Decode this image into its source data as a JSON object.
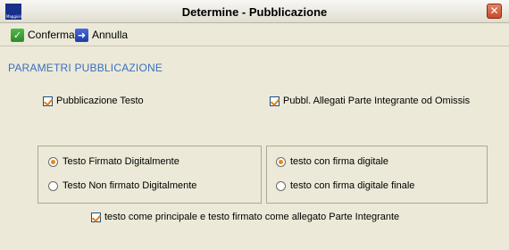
{
  "window": {
    "title": "Determine - Pubblicazione",
    "app_icon_text": "Maggioli",
    "close_glyph": "✕"
  },
  "toolbar": {
    "confirm_label": "Conferma",
    "cancel_label": "Annulla"
  },
  "section": {
    "title": "PARAMETRI PUBBLICAZIONE"
  },
  "checks": {
    "pub_testo": "Pubblicazione Testo",
    "pub_allegati": "Pubbl. Allegati Parte Integrante od Omissis",
    "principale": "testo come principale e testo firmato come allegato Parte Integrante"
  },
  "group_left": {
    "options": [
      "Testo Firmato Digitalmente",
      "Testo Non firmato Digitalmente"
    ],
    "selected": "Testo Firmato Digitalmente"
  },
  "group_right": {
    "options": [
      "testo con firma digitale",
      "testo con firma digitale finale"
    ],
    "selected": "testo con firma digitale"
  },
  "colors": {
    "section_title": "#3a6fbf",
    "radio_selected": "#e8871f",
    "check_mark": "#e07e1a"
  }
}
